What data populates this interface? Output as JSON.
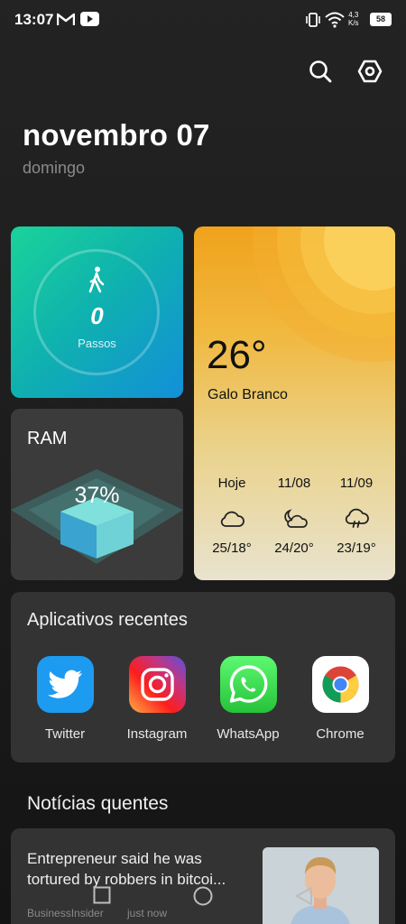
{
  "status_bar": {
    "time": "13:07",
    "net_speed_value": "4,3",
    "net_speed_unit": "K/s",
    "battery": "58",
    "icons": [
      "gmail-icon",
      "youtube-icon",
      "vibrate-icon",
      "wifi-icon",
      "battery-icon"
    ]
  },
  "header": {
    "date": "novembro 07",
    "weekday": "domingo",
    "icons": [
      "search-icon",
      "settings-icon"
    ]
  },
  "steps_widget": {
    "value": "0",
    "label": "Passos",
    "icon": "walking-icon",
    "colors": [
      "#1bd39a",
      "#138fd9"
    ]
  },
  "ram_widget": {
    "title": "RAM",
    "value": "37%"
  },
  "weather_widget": {
    "temperature": "26°",
    "city": "Galo Branco",
    "forecast": [
      {
        "day": "Hoje",
        "icon": "cloud-icon",
        "temp": "25/18°"
      },
      {
        "day": "11/08",
        "icon": "moon-cloud-icon",
        "temp": "24/20°"
      },
      {
        "day": "11/09",
        "icon": "rain-cloud-icon",
        "temp": "23/19°"
      }
    ]
  },
  "recent_apps": {
    "title": "Aplicativos recentes",
    "apps": [
      {
        "label": "Twitter",
        "icon": "twitter-icon"
      },
      {
        "label": "Instagram",
        "icon": "instagram-icon"
      },
      {
        "label": "WhatsApp",
        "icon": "whatsapp-icon"
      },
      {
        "label": "Chrome",
        "icon": "chrome-icon"
      }
    ]
  },
  "news": {
    "title": "Notícias quentes",
    "items": [
      {
        "headline": "Entrepreneur said he was tortured by robbers in bitcoi...",
        "source": "BusinessInsider",
        "time": "just now"
      }
    ]
  },
  "nav_bar": {
    "buttons": [
      "recents-square-icon",
      "home-circle-icon",
      "back-triangle-icon"
    ]
  }
}
